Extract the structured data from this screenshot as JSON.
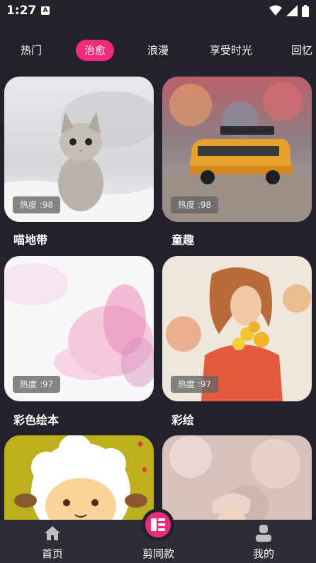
{
  "status": {
    "time": "1:27",
    "notif_letter": "A"
  },
  "tabs": [
    {
      "label": "热门",
      "active": false
    },
    {
      "label": "治愈",
      "active": true
    },
    {
      "label": "浪漫",
      "active": false
    },
    {
      "label": "享受时光",
      "active": false
    },
    {
      "label": "回忆",
      "active": false
    }
  ],
  "cards": [
    {
      "title": "喵地带",
      "heat": "热度 :98",
      "image": "kitten-photo"
    },
    {
      "title": "童趣",
      "heat": "热度 :98",
      "image": "toy-bus-photo"
    },
    {
      "title": "彩色绘本",
      "heat": "热度 :97",
      "image": "pink-watercolor-photo"
    },
    {
      "title": "彩绘",
      "heat": "热度 :97",
      "image": "painted-girl-flowers-photo"
    },
    {
      "title": "",
      "heat": "",
      "image": "cartoon-sheep-illustration"
    },
    {
      "title": "",
      "heat": "",
      "image": "cherry-blossom-photo"
    }
  ],
  "nav": {
    "home": "首页",
    "template": "剪同款",
    "mine": "我的"
  },
  "colors": {
    "accent": "#f12a7c",
    "background": "#232129",
    "nav_bg": "#2e2c34"
  }
}
